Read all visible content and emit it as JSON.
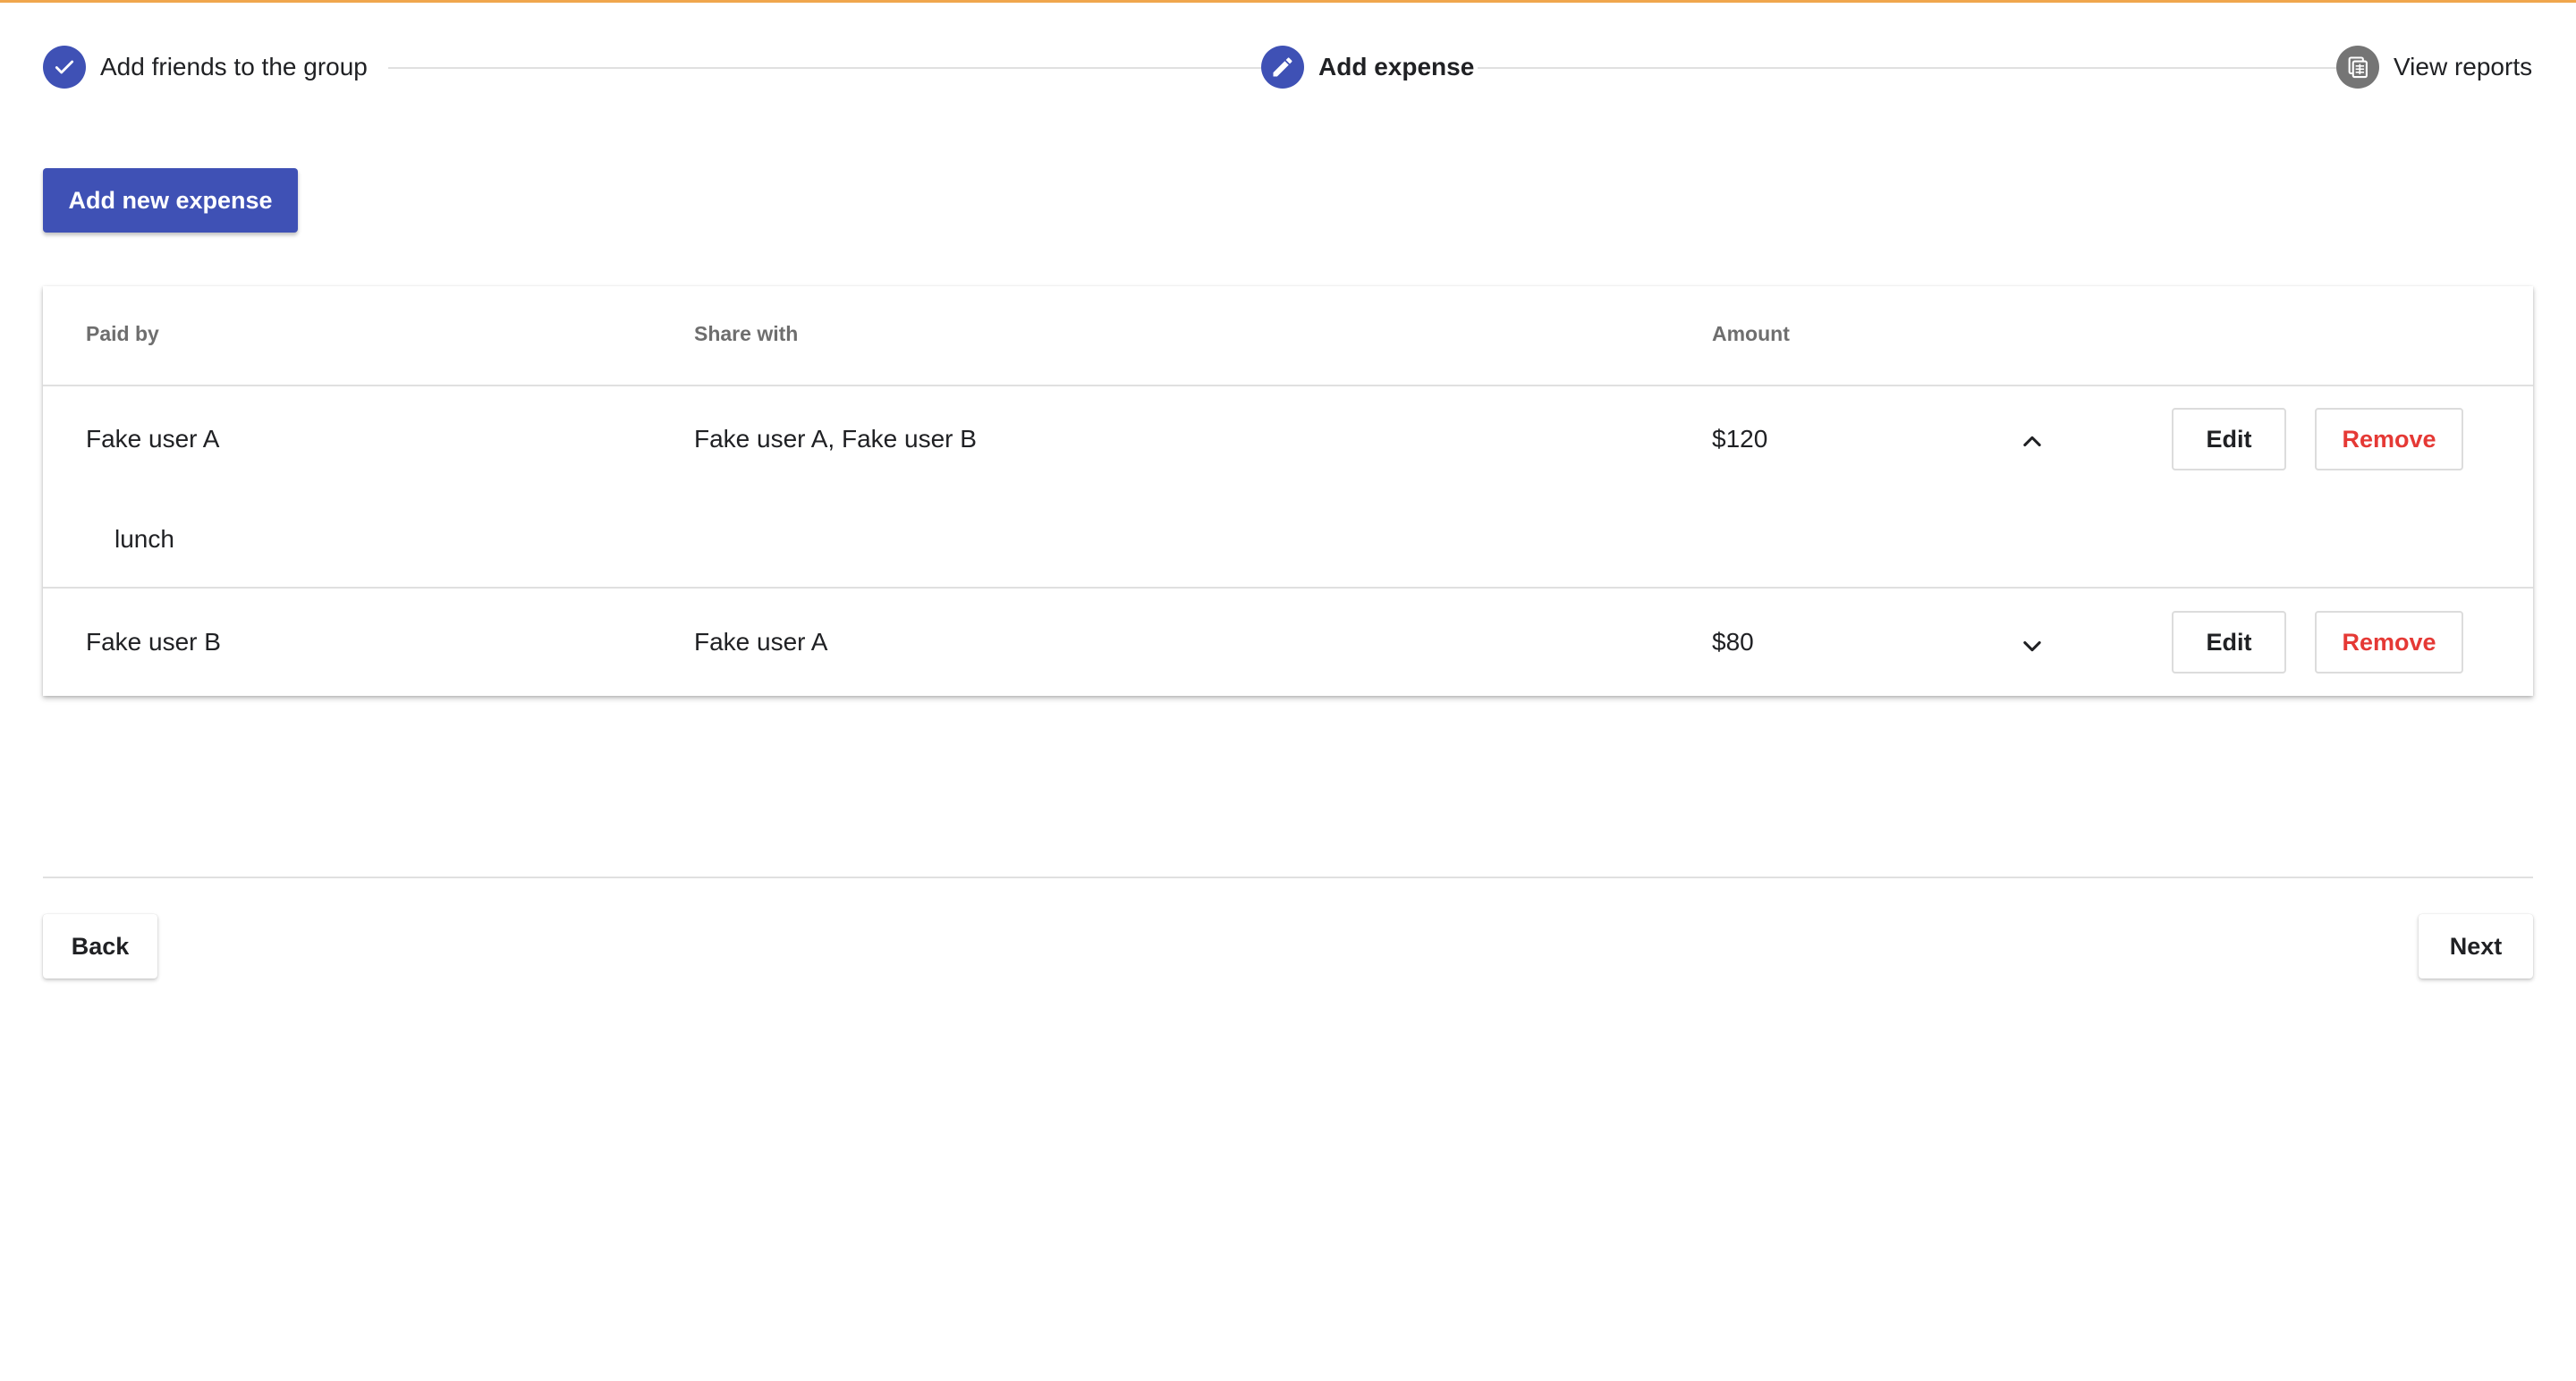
{
  "stepper": {
    "steps": [
      {
        "label": "Add friends to the group",
        "state": "done",
        "icon": "check-icon"
      },
      {
        "label": "Add expense",
        "state": "active",
        "icon": "pencil-icon"
      },
      {
        "label": "View reports",
        "state": "pending",
        "icon": "report-icon"
      }
    ]
  },
  "actions": {
    "add_label": "Add new expense"
  },
  "table": {
    "headers": {
      "paid_by": "Paid by",
      "share_with": "Share with",
      "amount": "Amount"
    },
    "rows": [
      {
        "paid_by": "Fake user A",
        "share_with": "Fake user A, Fake user B",
        "amount": "$120",
        "expanded": true,
        "toggle_icon": "chevron-up-icon",
        "detail": "lunch",
        "edit_label": "Edit",
        "remove_label": "Remove"
      },
      {
        "paid_by": "Fake user B",
        "share_with": "Fake user A",
        "amount": "$80",
        "expanded": false,
        "toggle_icon": "chevron-down-icon",
        "edit_label": "Edit",
        "remove_label": "Remove"
      }
    ]
  },
  "footer": {
    "back_label": "Back",
    "next_label": "Next"
  },
  "colors": {
    "accent": "#3f51b5",
    "danger": "#e53935",
    "top_bar": "#f0a64d",
    "pending_step": "#757575"
  }
}
